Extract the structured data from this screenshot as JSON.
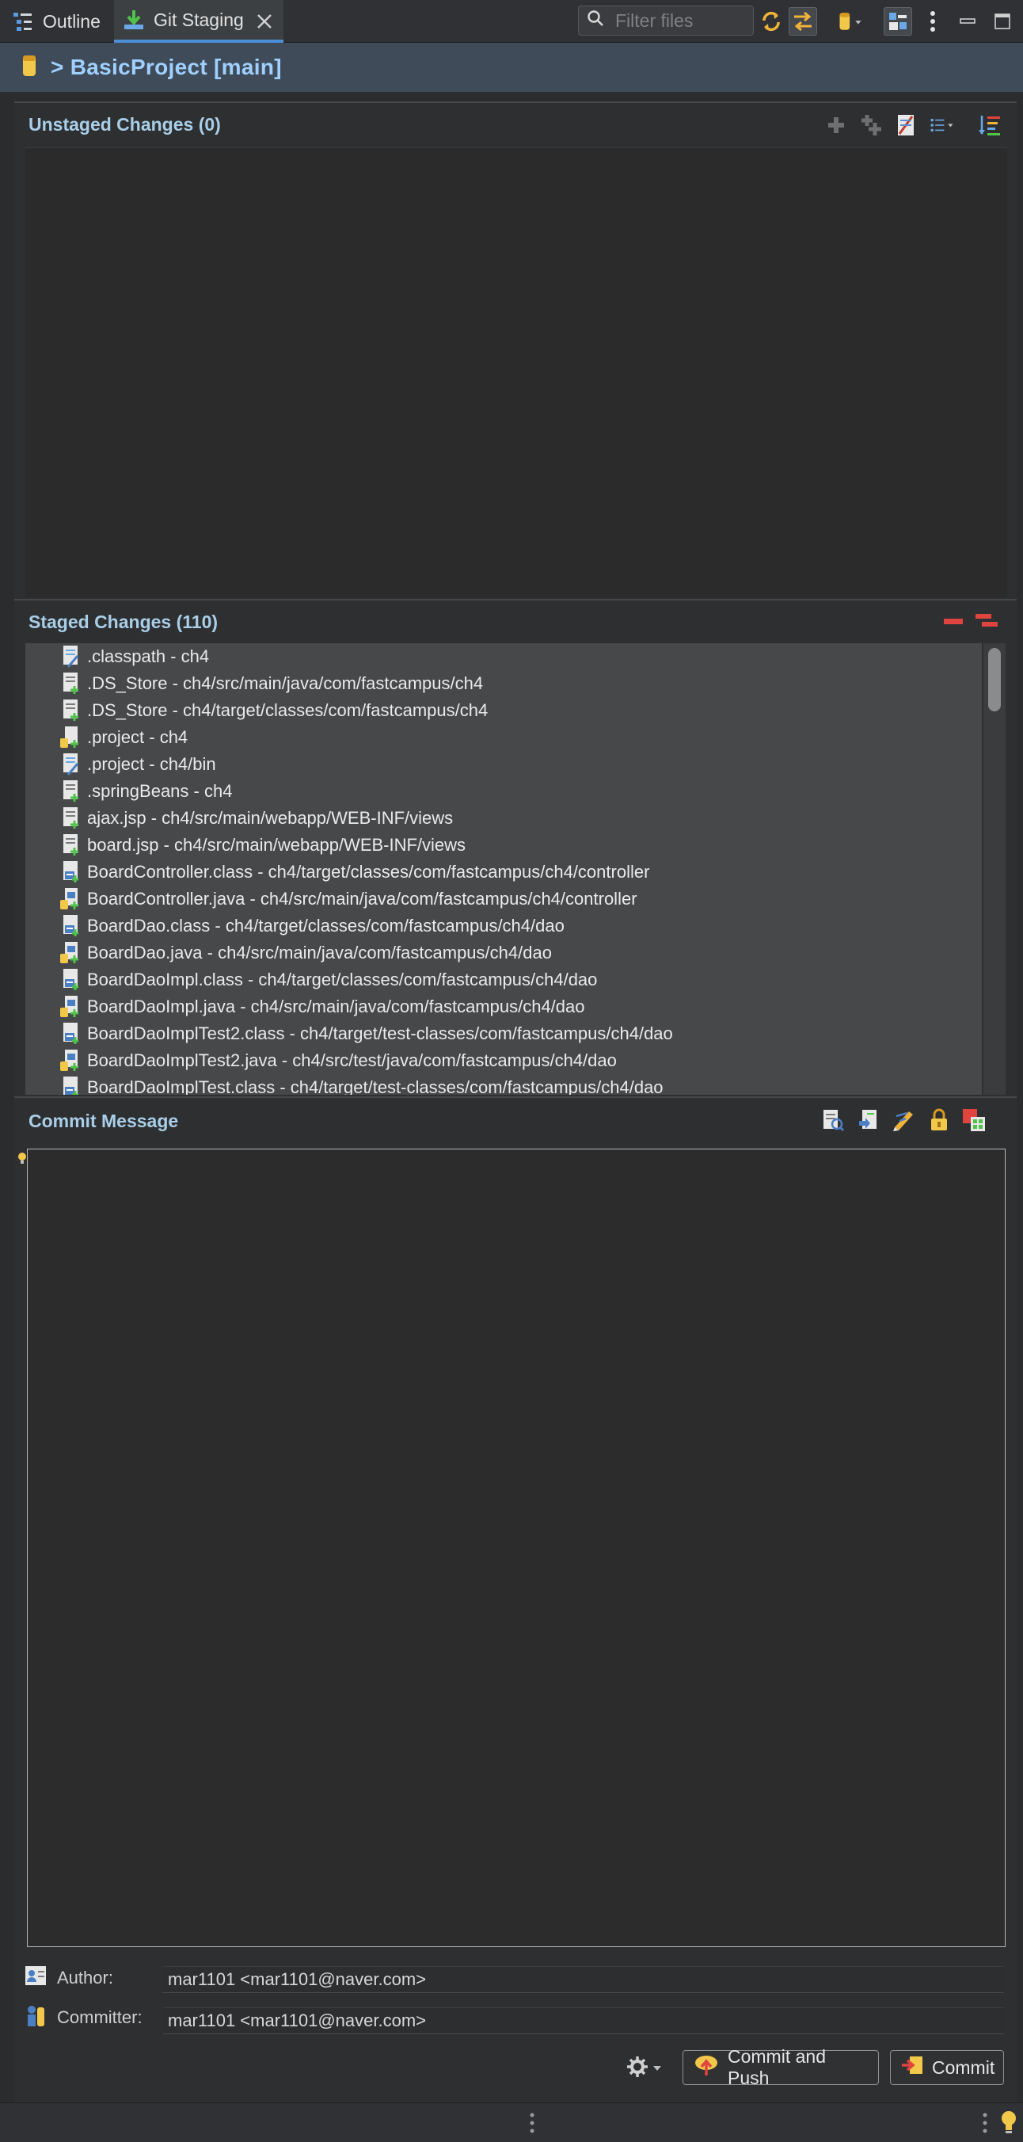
{
  "tabs": [
    {
      "label": "Outline",
      "icon": "outline-icon"
    },
    {
      "label": "Git Staging",
      "icon": "git-staging-icon"
    }
  ],
  "filter": {
    "placeholder": "Filter files"
  },
  "repo": {
    "title": "> BasicProject [main]"
  },
  "unstaged": {
    "title": "Unstaged Changes (0)"
  },
  "staged": {
    "title": "Staged Changes (110)",
    "files": [
      {
        "label": ".classpath - ch4",
        "status": "modified"
      },
      {
        "label": ".DS_Store - ch4/src/main/java/com/fastcampus/ch4",
        "status": "added"
      },
      {
        "label": ".DS_Store - ch4/target/classes/com/fastcampus/ch4",
        "status": "added"
      },
      {
        "label": ".project - ch4",
        "status": "added-project"
      },
      {
        "label": ".project - ch4/bin",
        "status": "modified"
      },
      {
        "label": ".springBeans - ch4",
        "status": "added"
      },
      {
        "label": "ajax.jsp - ch4/src/main/webapp/WEB-INF/views",
        "status": "added"
      },
      {
        "label": "board.jsp - ch4/src/main/webapp/WEB-INF/views",
        "status": "added"
      },
      {
        "label": "BoardController.class - ch4/target/classes/com/fastcampus/ch4/controller",
        "status": "class"
      },
      {
        "label": "BoardController.java - ch4/src/main/java/com/fastcampus/ch4/controller",
        "status": "java"
      },
      {
        "label": "BoardDao.class - ch4/target/classes/com/fastcampus/ch4/dao",
        "status": "class"
      },
      {
        "label": "BoardDao.java - ch4/src/main/java/com/fastcampus/ch4/dao",
        "status": "java"
      },
      {
        "label": "BoardDaoImpl.class - ch4/target/classes/com/fastcampus/ch4/dao",
        "status": "class"
      },
      {
        "label": "BoardDaoImpl.java - ch4/src/main/java/com/fastcampus/ch4/dao",
        "status": "java"
      },
      {
        "label": "BoardDaoImplTest2.class - ch4/target/test-classes/com/fastcampus/ch4/dao",
        "status": "class"
      },
      {
        "label": "BoardDaoImplTest2.java - ch4/src/test/java/com/fastcampus/ch4/dao",
        "status": "java"
      },
      {
        "label": "BoardDaoImplTest.class - ch4/target/test-classes/com/fastcampus/ch4/dao",
        "status": "class"
      }
    ]
  },
  "commit": {
    "title": "Commit Message",
    "message": "",
    "author_label": "Author:",
    "author_value": "mar1101 <mar1101@naver.com>",
    "committer_label": "Committer:",
    "committer_value": "mar1101 <mar1101@naver.com>",
    "commit_push_label": "Commit and Push",
    "commit_label": "Commit"
  },
  "colors": {
    "accent": "#4b8fd8",
    "title_text": "#a9cfe8",
    "repo_text": "#9fd0ff",
    "remove_red": "#e0443e"
  }
}
